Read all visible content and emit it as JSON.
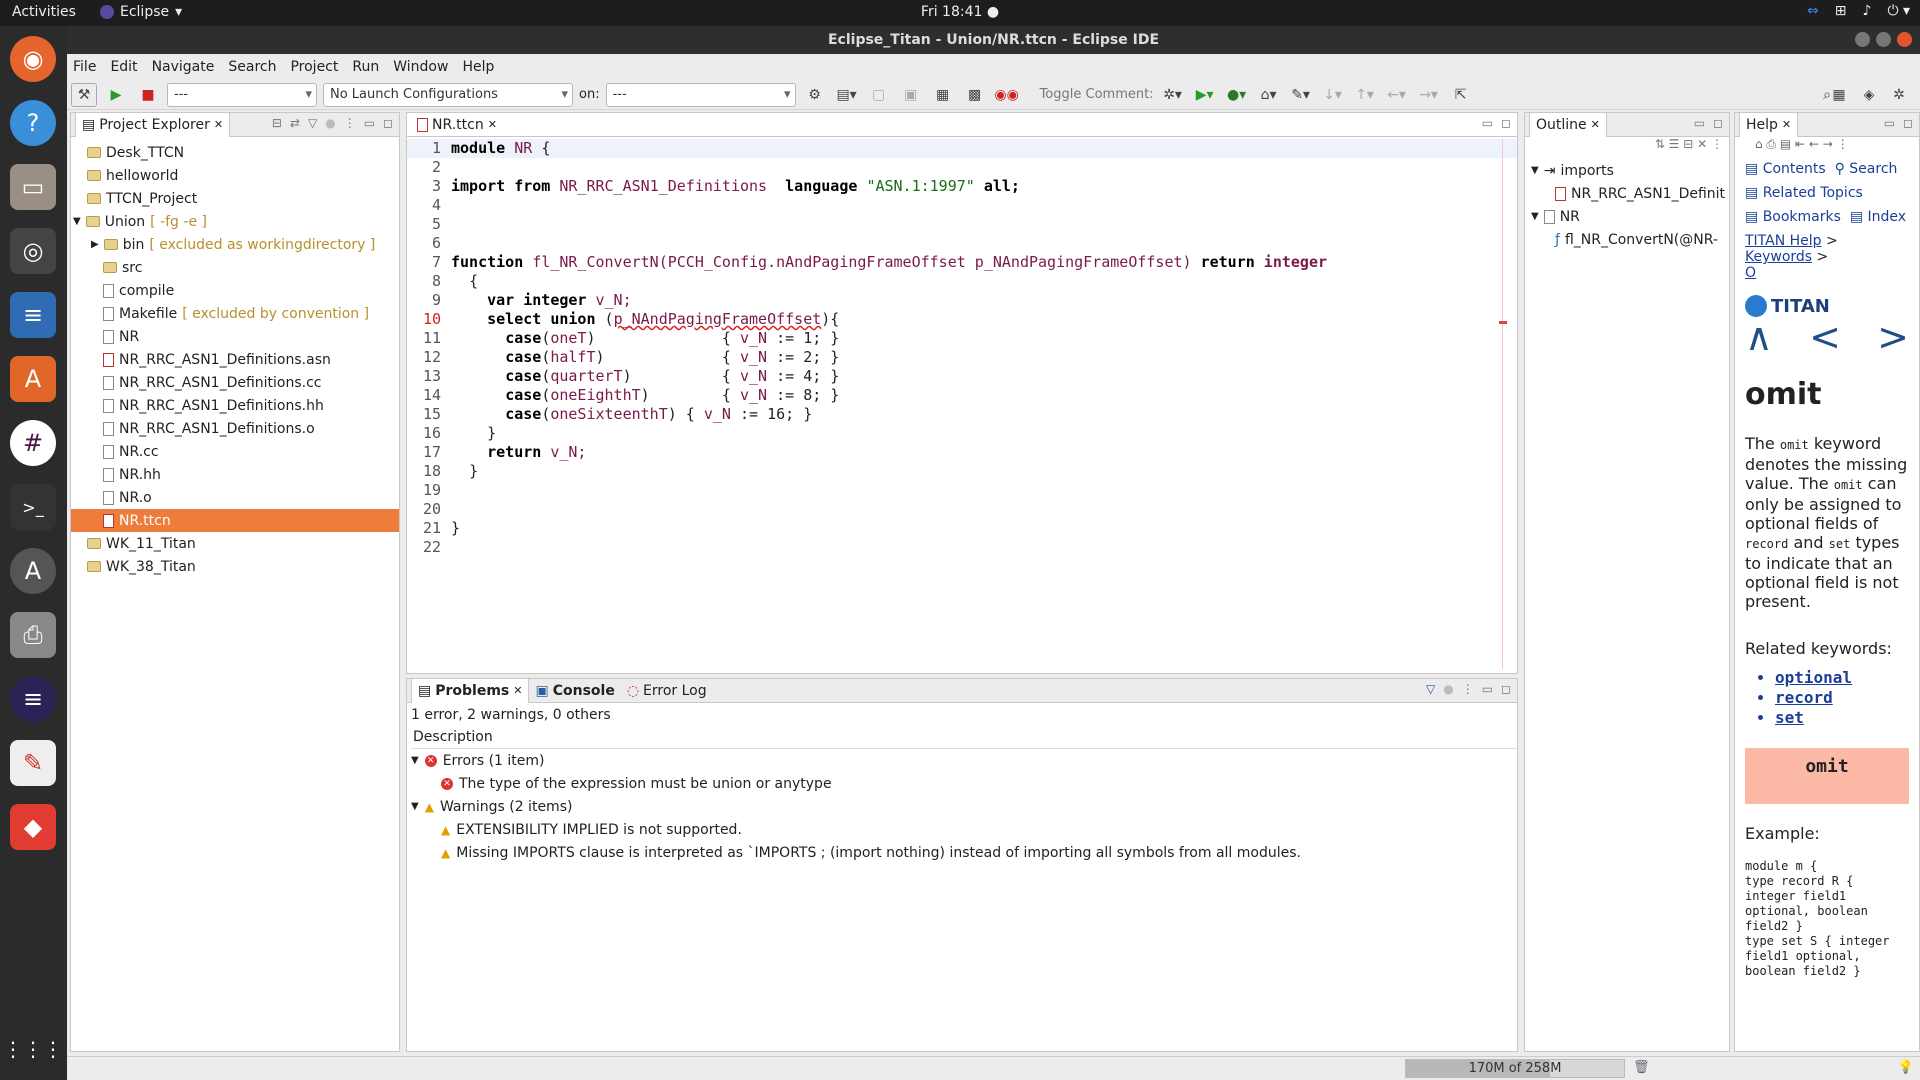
{
  "topbar": {
    "activities": "Activities",
    "app": "Eclipse",
    "clock": "Fri 18:41 ●"
  },
  "window": {
    "title": "Eclipse_Titan - Union/NR.ttcn - Eclipse IDE"
  },
  "menu": [
    "File",
    "Edit",
    "Navigate",
    "Search",
    "Project",
    "Run",
    "Window",
    "Help"
  ],
  "toolbar": {
    "run_target": "---",
    "launch": "No Launch Configurations",
    "on_label": "on:",
    "on_target": "---",
    "toggle_comment": "Toggle Comment:"
  },
  "explorer": {
    "title": "Project Explorer",
    "items": [
      {
        "label": "Desk_TTCN",
        "deco": ""
      },
      {
        "label": "helloworld",
        "deco": ""
      },
      {
        "label": "TTCN_Project",
        "deco": ""
      },
      {
        "label": "Union",
        "deco": "[ -fg -e ]"
      },
      {
        "label": "bin",
        "deco": "[ excluded as workingdirectory ]"
      },
      {
        "label": "src",
        "deco": ""
      },
      {
        "label": "compile",
        "deco": ""
      },
      {
        "label": "Makefile",
        "deco": "[ excluded by convention ]"
      },
      {
        "label": "NR",
        "deco": ""
      },
      {
        "label": "NR_RRC_ASN1_Definitions.asn",
        "deco": ""
      },
      {
        "label": "NR_RRC_ASN1_Definitions.cc",
        "deco": ""
      },
      {
        "label": "NR_RRC_ASN1_Definitions.hh",
        "deco": ""
      },
      {
        "label": "NR_RRC_ASN1_Definitions.o",
        "deco": ""
      },
      {
        "label": "NR.cc",
        "deco": ""
      },
      {
        "label": "NR.hh",
        "deco": ""
      },
      {
        "label": "NR.o",
        "deco": ""
      },
      {
        "label": "NR.ttcn",
        "deco": ""
      },
      {
        "label": "WK_11_Titan",
        "deco": ""
      },
      {
        "label": "WK_38_Titan",
        "deco": ""
      }
    ]
  },
  "editor": {
    "tab": "NR.ttcn",
    "line_numbers": [
      "1",
      "2",
      "3",
      "4",
      "5",
      "6",
      "7",
      "8",
      "10",
      "11",
      "12",
      "13",
      "14",
      "15",
      "16",
      "17",
      "18",
      "19",
      "20",
      "21",
      "22"
    ],
    "l1": [
      "module",
      "NR",
      "{"
    ],
    "l3": [
      "import from",
      "NR_RRC_ASN1_Definitions",
      "language",
      "\"ASN.1:1997\"",
      "all;"
    ],
    "l7": [
      "function",
      "fl_NR_ConvertN",
      "(PCCH_Config.nAndPagingFrameOffset",
      "p_NAndPagingFrameOffset)",
      "return",
      "integer"
    ],
    "l8": "{",
    "l9": [
      "var integer",
      "v_N;"
    ],
    "l10": [
      "select union",
      "(",
      "p_NAndPagingFrameOffset",
      "){"
    ],
    "cases": [
      {
        "sel": "oneT",
        "pad": "        ",
        "val": "1"
      },
      {
        "sel": "halfT",
        "pad": "       ",
        "val": "2"
      },
      {
        "sel": "quarterT",
        "pad": "    ",
        "val": "4"
      },
      {
        "sel": "oneEighthT",
        "pad": "  ",
        "val": "8"
      },
      {
        "sel": "oneSixteenthT",
        "pad": "",
        "val": "16"
      }
    ],
    "l16": "}",
    "l17": [
      "return",
      "v_N;"
    ],
    "l18": "}",
    "l21": "}",
    "case_kw": "case",
    "vn": "v_N",
    "assign": ":="
  },
  "problems": {
    "tabs": [
      "Problems",
      "Console",
      "Error Log"
    ],
    "summary": "1 error, 2 warnings, 0 others",
    "col": "Description",
    "errors_group": "Errors (1 item)",
    "error1": "The type of the expression must be union or anytype",
    "warnings_group": "Warnings (2 items)",
    "warn1": "EXTENSIBILITY IMPLIED is not supported.",
    "warn2": "Missing IMPORTS clause is interpreted as `IMPORTS ; (import nothing) instead of importing all symbols from all modules."
  },
  "outline": {
    "title": "Outline",
    "imports": "imports",
    "imp1": "NR_RRC_ASN1_Definit",
    "nr": "NR",
    "fn": "fl_NR_ConvertN(@NR-"
  },
  "help": {
    "title": "Help",
    "contents": "Contents",
    "search": "Search",
    "related": "Related Topics",
    "bookmarks": "Bookmarks",
    "index": "Index",
    "crumb1": "TITAN Help",
    "crumb_sep": ">",
    "crumb2": "Keywords",
    "crumb3": "O",
    "logo": "TITAN",
    "heading": "omit",
    "p_a": "The",
    "p_b": "omit",
    "p_c": "keyword denotes the missing value. The",
    "p_d": "omit",
    "p_e": "can only be assigned to optional fields of",
    "p_f": "record",
    "p_g": "and",
    "p_h": "set",
    "p_i": "types to indicate that an optional field is not present.",
    "related_kw": "Related keywords:",
    "kw": [
      "optional",
      "record",
      "set"
    ],
    "box": "omit",
    "example": "Example:",
    "code": "module m {\ntype record R {\ninteger field1\noptional, boolean\nfield2 }\ntype set S { integer\nfield1 optional,\nboolean field2 }"
  },
  "status": {
    "heap": "170M of 258M"
  }
}
